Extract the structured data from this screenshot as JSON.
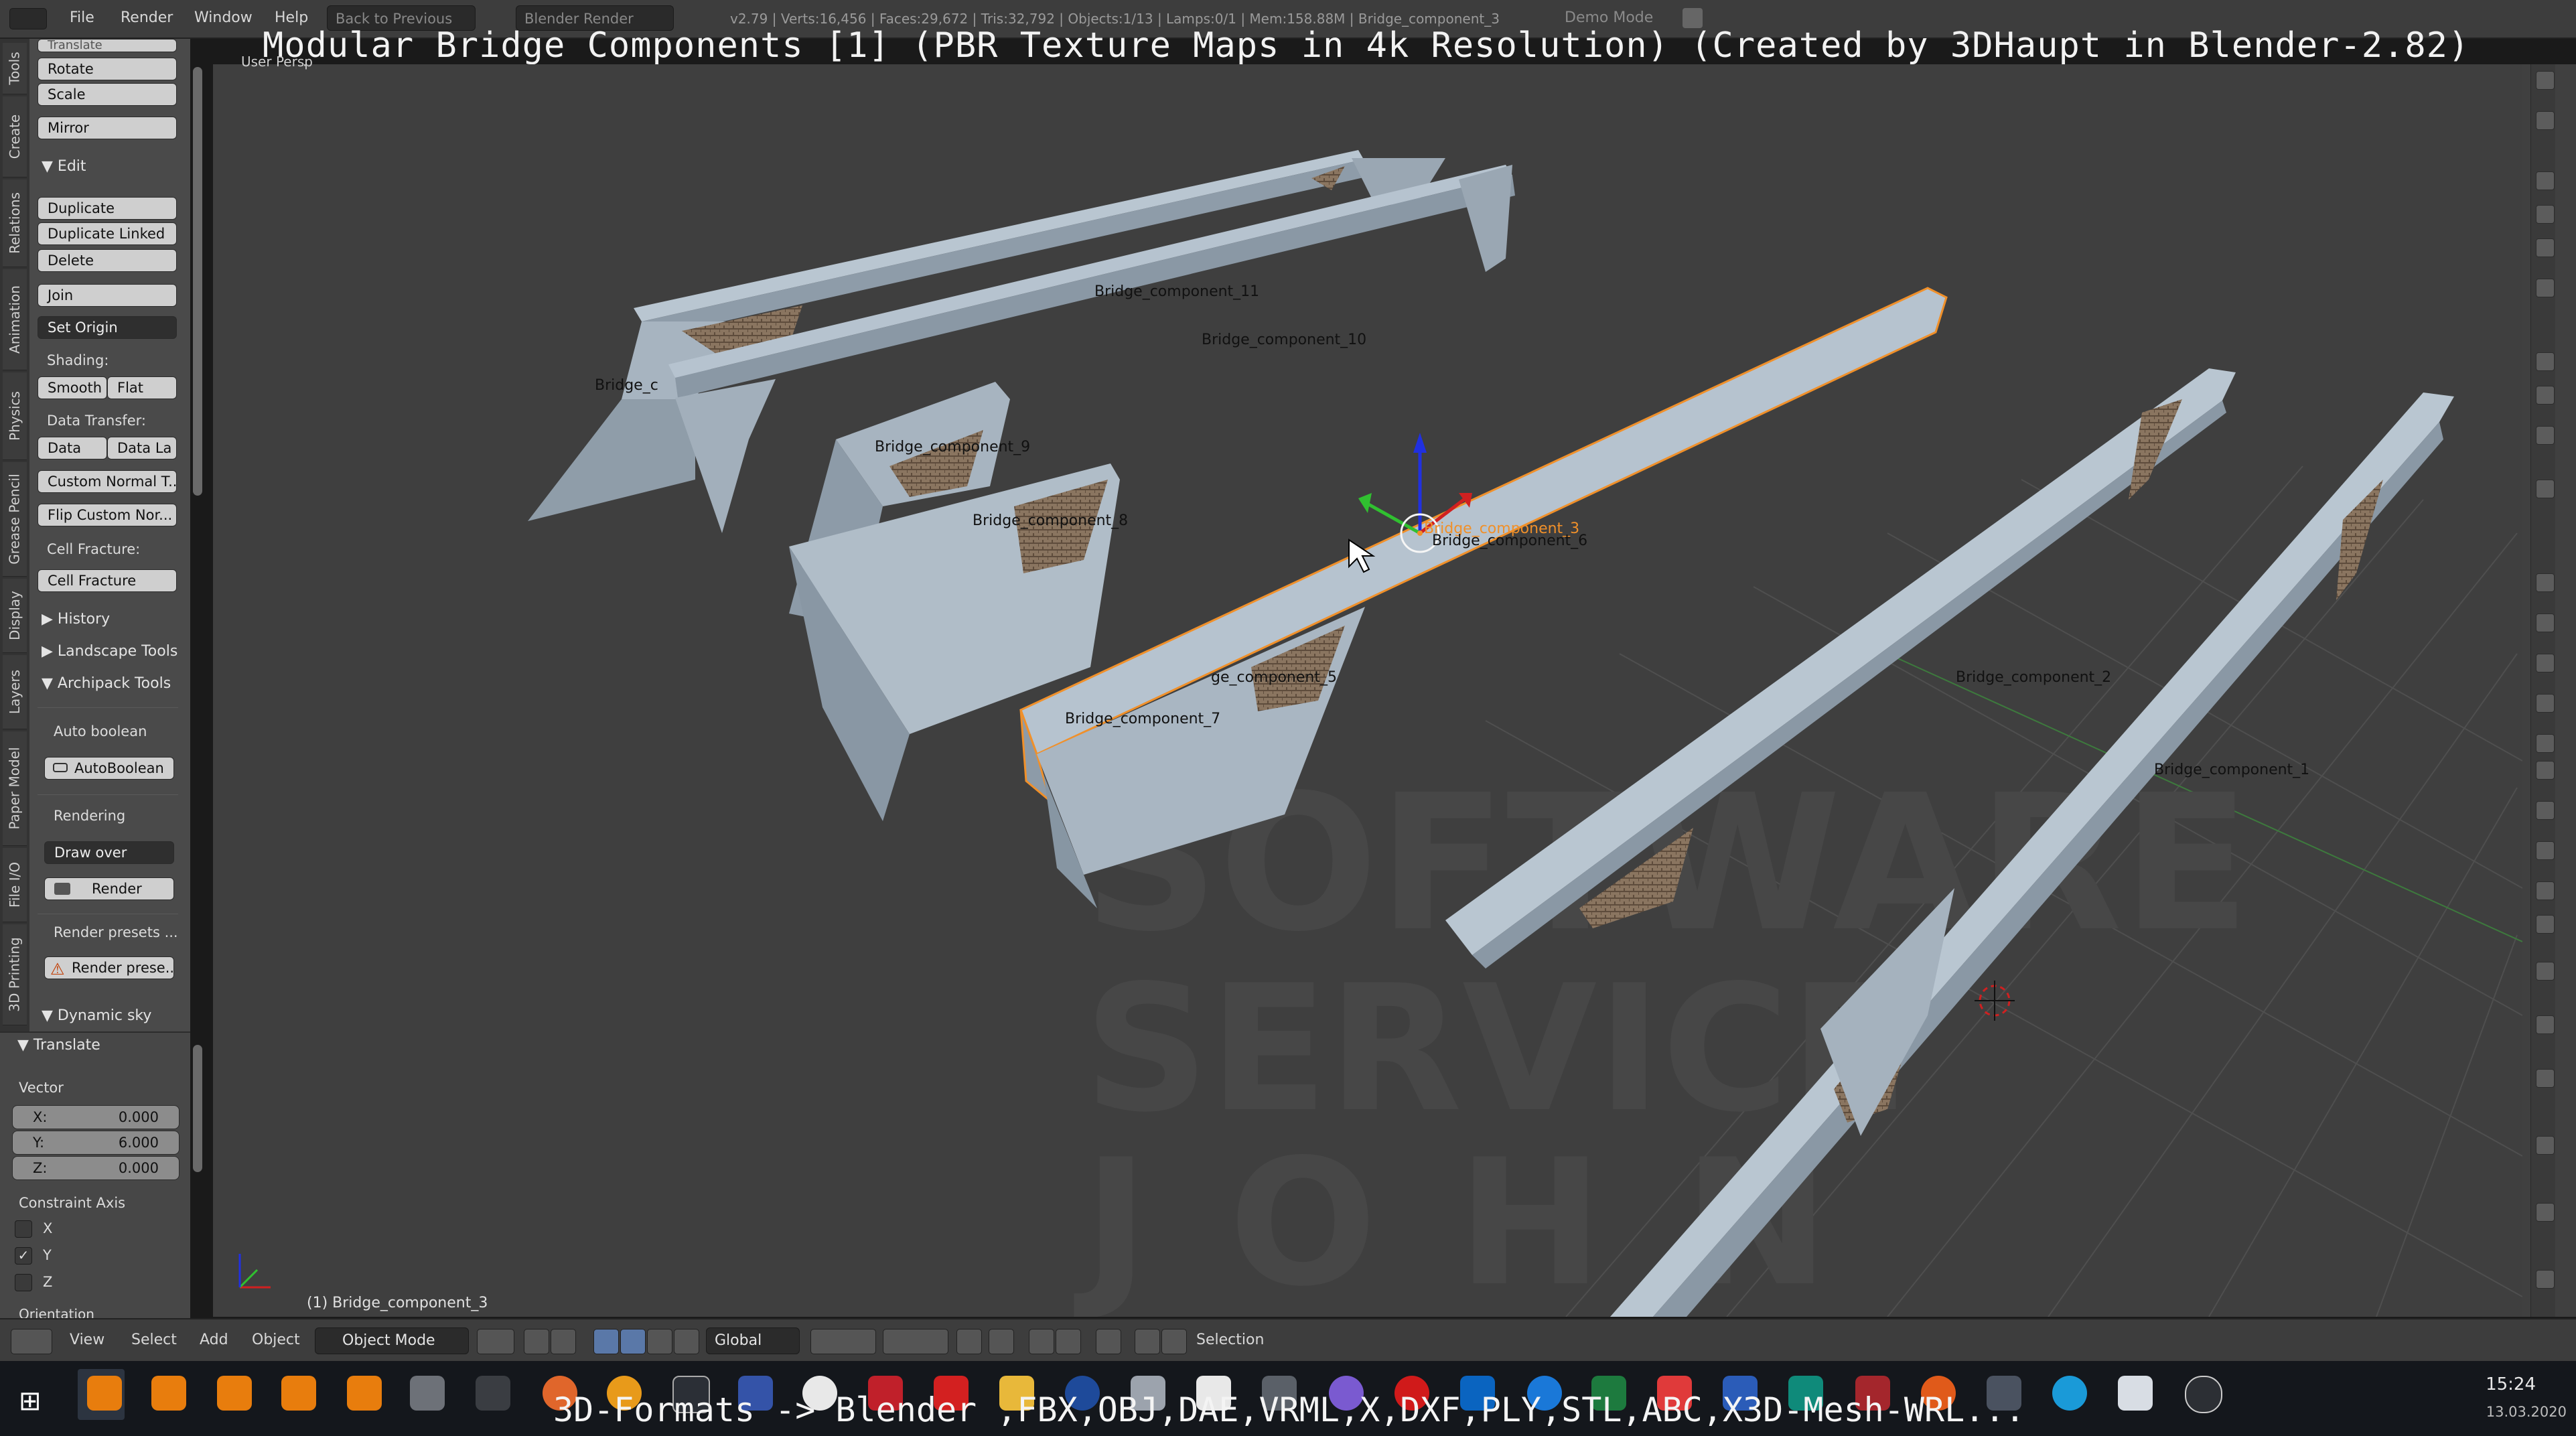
{
  "overlay": {
    "title": "Modular Bridge Components [1] (PBR Texture Maps in 4k Resolution) (Created by 3DHaupt in Blender-2.82)",
    "subtitle": "3D-Formats -> Blender ,FBX,OBJ,DAE,VRML,X,DXF,PLY,STL,ABC,X3D-Mesh-WRL..."
  },
  "header": {
    "menus": [
      "File",
      "Render",
      "Window",
      "Help"
    ],
    "back_button": "Back to Previous",
    "engine": "Blender Render",
    "stats": "v2.79 | Verts:16,456 | Faces:29,672 | Tris:32,792 | Objects:1/13 | Lamps:0/1 | Mem:158.88M | Bridge_component_3",
    "mode_label": "Demo Mode"
  },
  "vertical_tabs": [
    "Tools",
    "Create",
    "Relations",
    "Animation",
    "Physics",
    "Grease Pencil",
    "Display",
    "Layers",
    "Paper Model",
    "File I/O",
    "3D Printing"
  ],
  "tool_shelf": {
    "transform": {
      "header": "Translate",
      "buttons": [
        "Rotate",
        "Scale",
        "Mirror"
      ]
    },
    "edit": {
      "header": "Edit",
      "buttons": [
        "Duplicate",
        "Duplicate Linked",
        "Delete",
        "Join"
      ],
      "set_origin": "Set Origin",
      "shading_label": "Shading:",
      "shading_buttons": [
        "Smooth",
        "Flat"
      ],
      "data_transfer_label": "Data Transfer:",
      "data_transfer_buttons": [
        "Data",
        "Data La"
      ],
      "custom_normal_buttons": [
        "Custom Normal T...",
        "Flip Custom Nor..."
      ],
      "cell_fracture_label": "Cell Fracture:",
      "cell_fracture_button": "Cell Fracture"
    },
    "history": "History",
    "landscape": "Landscape Tools",
    "archipack": {
      "header": "Archipack Tools",
      "auto_boolean_label": "Auto boolean",
      "auto_boolean_button": "AutoBoolean",
      "rendering_label": "Rendering",
      "draw_over": "Draw over",
      "render_button": "Render",
      "render_presets_label": "Render presets ...",
      "render_presets_button": "Render prese..."
    },
    "dynamic_sky": "Dynamic sky"
  },
  "operator_panel": {
    "header": "Translate",
    "vector_label": "Vector",
    "vector": [
      {
        "axis": "X:",
        "value": "0.000"
      },
      {
        "axis": "Y:",
        "value": "6.000"
      },
      {
        "axis": "Z:",
        "value": "0.000"
      }
    ],
    "constraint_label": "Constraint Axis",
    "constraints": [
      {
        "axis": "X",
        "checked": false
      },
      {
        "axis": "Y",
        "checked": true
      },
      {
        "axis": "Z",
        "checked": false
      }
    ],
    "orientation_label": "Orientation"
  },
  "viewport": {
    "view_name": "User Persp",
    "active_object": "(1) Bridge_component_3",
    "objects": [
      "Bridge_component_11",
      "Bridge_component_10",
      "Bridge_c",
      "Bridge_component_9",
      "Bridge_component_8",
      "Bridge_component_3",
      "Bridge_component_6",
      "ge_component_5",
      "Bridge_component_7",
      "Bridge_component_2",
      "Bridge_component_1"
    ],
    "watermark": [
      "SOFTWARE",
      "SERVICE",
      "JOHN"
    ]
  },
  "bottom_bar": {
    "menus": [
      "View",
      "Select",
      "Add",
      "Object"
    ],
    "mode": "Object Mode",
    "orientation": "Global",
    "selection_label": "Selection"
  },
  "taskbar": {
    "time": "15:24",
    "date": "13.03.2020"
  },
  "colors": {
    "panel": "#4a4a4a",
    "viewport": "#3f3f3f",
    "mesh": "#a3b3c3",
    "selected_outline": "#f0902a",
    "axis_x": "#d02020",
    "axis_y": "#30c030",
    "axis_z": "#2030e0"
  }
}
